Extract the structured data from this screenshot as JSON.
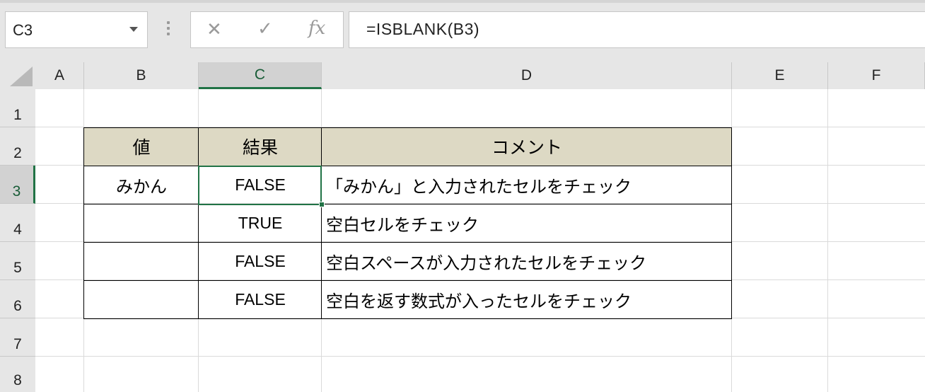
{
  "name_box": {
    "value": "C3"
  },
  "formula_bar": {
    "cancel_glyph": "✕",
    "enter_glyph": "✓",
    "fx_glyph": "fx",
    "formula": "=ISBLANK(B3)"
  },
  "columns": [
    "A",
    "B",
    "C",
    "D",
    "E",
    "F"
  ],
  "rows": [
    "1",
    "2",
    "3",
    "4",
    "5",
    "6",
    "7",
    "8"
  ],
  "selected_cell": {
    "column": "C",
    "row": "3"
  },
  "table": {
    "headers": [
      "値",
      "結果",
      "コメント"
    ],
    "header_fill": "#ddd9c4",
    "rows": [
      {
        "value": "みかん",
        "result": "FALSE",
        "comment": "「みかん」と入力されたセルをチェック"
      },
      {
        "value": "",
        "result": "TRUE",
        "comment": "空白セルをチェック"
      },
      {
        "value": "",
        "result": "FALSE",
        "comment": "空白スペースが入力されたセルをチェック"
      },
      {
        "value": "",
        "result": "FALSE",
        "comment": "空白を返す数式が入ったセルをチェック"
      }
    ]
  },
  "colors": {
    "accent": "#217346",
    "header_bg": "#e6e6e6"
  }
}
